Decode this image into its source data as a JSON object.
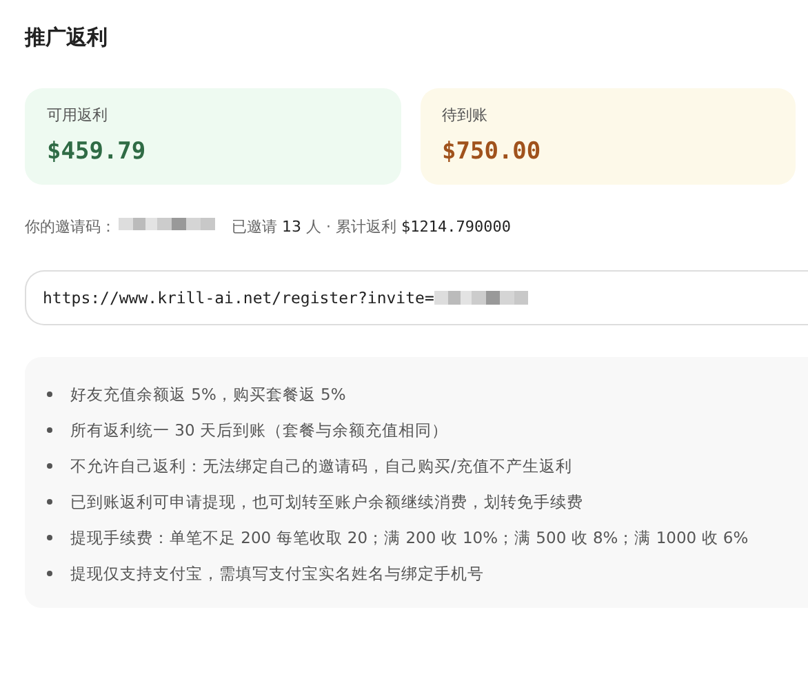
{
  "title": "推广返利",
  "cards": [
    {
      "label": "可用返利",
      "value": "$459.79",
      "color": "#eefaf1"
    },
    {
      "label": "待到账",
      "value": "$750.00",
      "color": "#fdf9e9"
    }
  ],
  "invite": {
    "code_label": "你的邀请码：",
    "invited_prefix": "已邀请",
    "invited_count": "13",
    "invited_suffix": "人 · 累计返利",
    "total": "$1214.790000"
  },
  "link": {
    "value": "https://www.krill-ai.net/register?invite="
  },
  "rules": [
    "好友充值余额返 5%，购买套餐返 5%",
    "所有返利统一 30 天后到账（套餐与余额充值相同）",
    "不允许自己返利：无法绑定自己的邀请码，自己购买/充值不产生返利",
    "已到账返利可申请提现，也可划转至账户余额继续消费，划转免手续费",
    "提现手续费：单笔不足 200 每笔收取 20；满 200 收 10%；满 500 收 8%；满 1000 收 6%",
    "提现仅支持支付宝，需填写支付宝实名姓名与绑定手机号"
  ]
}
